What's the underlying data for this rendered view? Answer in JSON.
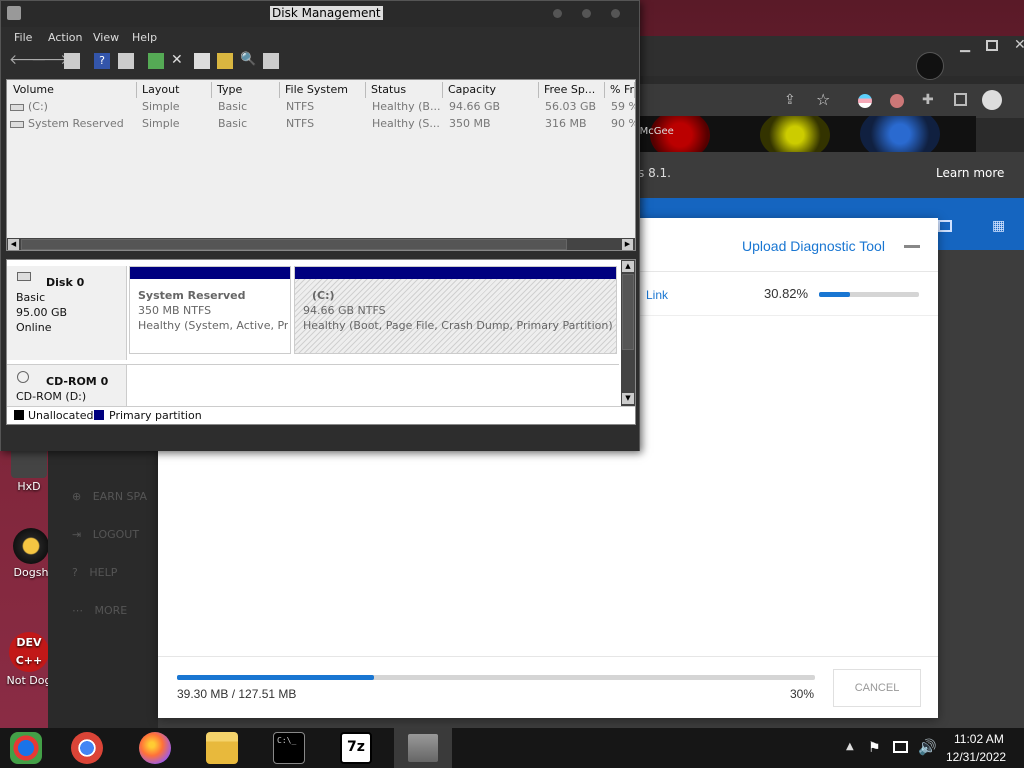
{
  "desktop": {
    "icons": [
      {
        "label": "HxD"
      },
      {
        "label": "Dogsh"
      },
      {
        "label": "Not Dog"
      }
    ],
    "dev_icon_text": "DEV C++"
  },
  "browser": {
    "banner_text": "Espectral McGee",
    "windows_version_fragment": "s 8.1.",
    "learn_more": "Learn more",
    "sidebar": [
      "EARN SPA",
      "LOGOUT",
      "HELP",
      "MORE"
    ]
  },
  "upload": {
    "title": "Upload Diagnostic Tool",
    "link_label": "Link",
    "link_percent": "30.82%",
    "link_progress": 0.3082,
    "transferred": "39.30 MB / 127.51 MB",
    "total_percent": "30%",
    "total_progress": 0.308,
    "cancel_label": "CANCEL"
  },
  "dm": {
    "title": "Disk Management",
    "menu": [
      "File",
      "Action",
      "View",
      "Help"
    ],
    "columns": [
      "Volume",
      "Layout",
      "Type",
      "File System",
      "Status",
      "Capacity",
      "Free Sp...",
      "% Fr"
    ],
    "rows": [
      [
        "(C:)",
        "Simple",
        "Basic",
        "NTFS",
        "Healthy (B...",
        "94.66 GB",
        "56.03 GB",
        "59 %"
      ],
      [
        "System Reserved",
        "Simple",
        "Basic",
        "NTFS",
        "Healthy (S...",
        "350 MB",
        "316 MB",
        "90 %"
      ]
    ],
    "disk0": {
      "name": "Disk 0",
      "type": "Basic",
      "size": "95.00 GB",
      "state": "Online",
      "p1": {
        "name": "System Reserved",
        "size": "350 MB NTFS",
        "status": "Healthy (System, Active, Prin"
      },
      "p2": {
        "name": "(C:)",
        "size": "94.66 GB NTFS",
        "status": "Healthy (Boot, Page File, Crash Dump, Primary Partition)"
      }
    },
    "cdrom": {
      "name": "CD-ROM 0",
      "drive": "CD-ROM (D:)"
    },
    "legend": [
      "Unallocated",
      "Primary partition"
    ]
  },
  "taskbar": {
    "time": "11:02 AM",
    "date": "12/31/2022",
    "sevenzip": "7z",
    "cmd": "C:\\_"
  },
  "colors": {
    "accent_blue": "#1976d2",
    "partition_header": "#00007f",
    "progress_bg": "#d5d5d5"
  }
}
